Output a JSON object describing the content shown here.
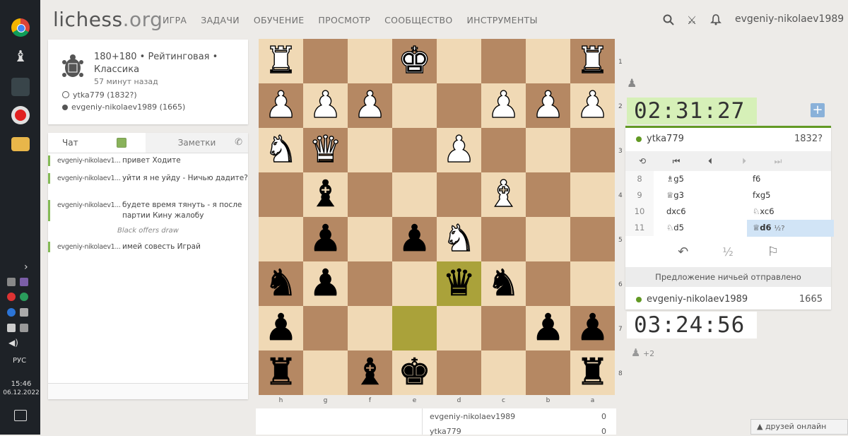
{
  "taskbar": {
    "lang": "РУС",
    "time": "15:46",
    "date": "06.12.2022"
  },
  "header": {
    "logo_main": "lichess",
    "logo_org": ".org",
    "nav": [
      "ИГРА",
      "ЗАДАЧИ",
      "ОБУЧЕНИЕ",
      "ПРОСМОТР",
      "СООБЩЕСТВО",
      "ИНСТРУМЕНТЫ"
    ],
    "username": "evgeniy-nikolaev1989"
  },
  "game_info": {
    "title": "180+180 • Рейтинговая • Классика",
    "ago": "57 минут назад",
    "white_player": "ytka779",
    "white_rating": "(1832?)",
    "black_player": "evgeniy-nikolaev1989",
    "black_rating": "(1665)"
  },
  "chat": {
    "tab_chat": "Чат",
    "tab_notes": "Заметки",
    "messages": [
      {
        "author": "evgeniy-nikolaev1...",
        "text": "привет Ходите"
      },
      {
        "author": "evgeniy-nikolaev1...",
        "text": "уйти я не уйду - Ничью дадите?"
      },
      {
        "author": "evgeniy-nikolaev1...",
        "text": "будете время тянуть - я после партии Кину жалобу"
      },
      {
        "author": "evgeniy-nikolaev1...",
        "text": "имей совесть Играй"
      }
    ],
    "system": "Black offers draw"
  },
  "board": {
    "files_bottom": [
      "h",
      "g",
      "f",
      "e",
      "d",
      "c",
      "b",
      "a"
    ],
    "ranks_right": [
      "1",
      "2",
      "3",
      "4",
      "5",
      "6",
      "7",
      "8"
    ],
    "highlight": [
      "d6",
      "e7"
    ],
    "pieces": [
      {
        "sq": "h1",
        "p": "♜",
        "c": "w"
      },
      {
        "sq": "e1",
        "p": "♚",
        "c": "w"
      },
      {
        "sq": "a1",
        "p": "♜",
        "c": "w"
      },
      {
        "sq": "h2",
        "p": "♟",
        "c": "w"
      },
      {
        "sq": "g2",
        "p": "♟",
        "c": "w"
      },
      {
        "sq": "f2",
        "p": "♟",
        "c": "w"
      },
      {
        "sq": "c2",
        "p": "♟",
        "c": "w"
      },
      {
        "sq": "b2",
        "p": "♟",
        "c": "w"
      },
      {
        "sq": "a2",
        "p": "♟",
        "c": "w"
      },
      {
        "sq": "h3",
        "p": "♞",
        "c": "w"
      },
      {
        "sq": "g3",
        "p": "♛",
        "c": "w"
      },
      {
        "sq": "d3",
        "p": "♟",
        "c": "w"
      },
      {
        "sq": "g4",
        "p": "♝",
        "c": "b"
      },
      {
        "sq": "c4",
        "p": "♝",
        "c": "w"
      },
      {
        "sq": "g5",
        "p": "♟",
        "c": "b"
      },
      {
        "sq": "e5",
        "p": "♟",
        "c": "b"
      },
      {
        "sq": "d5",
        "p": "♞",
        "c": "w"
      },
      {
        "sq": "h6",
        "p": "♞",
        "c": "b"
      },
      {
        "sq": "g6",
        "p": "♟",
        "c": "b"
      },
      {
        "sq": "d6",
        "p": "♛",
        "c": "b"
      },
      {
        "sq": "c6",
        "p": "♞",
        "c": "b"
      },
      {
        "sq": "h7",
        "p": "♟",
        "c": "b"
      },
      {
        "sq": "b7",
        "p": "♟",
        "c": "b"
      },
      {
        "sq": "a7",
        "p": "♟",
        "c": "b"
      },
      {
        "sq": "h8",
        "p": "♜",
        "c": "b"
      },
      {
        "sq": "f8",
        "p": "♝",
        "c": "b"
      },
      {
        "sq": "e8",
        "p": "♚",
        "c": "b"
      },
      {
        "sq": "a8",
        "p": "♜",
        "c": "b"
      }
    ]
  },
  "under_board": {
    "rows": [
      {
        "name": "evgeniy-nikolaev1989",
        "score": "0"
      },
      {
        "name": "ytka779",
        "score": "0"
      }
    ]
  },
  "right_panel": {
    "clock_top": "02:31:27",
    "clock_bottom": "03:24:56",
    "top_player": "ytka779",
    "top_rating": "1832?",
    "bottom_player": "evgeniy-nikolaev1989",
    "bottom_rating": "1665",
    "moves": [
      {
        "n": "8",
        "w": "♗g5",
        "b": "f6",
        "ann": ""
      },
      {
        "n": "9",
        "w": "♕g3",
        "b": "fxg5",
        "ann": ""
      },
      {
        "n": "10",
        "w": "dxc6",
        "b": "♘xc6",
        "ann": ""
      },
      {
        "n": "11",
        "w": "♘d5",
        "b": "♕d6",
        "ann": "½?"
      }
    ],
    "draw_half": "½",
    "draw_sent": "Предложение ничьей отправлено",
    "spectators": "+2"
  },
  "footer": {
    "friends": "▲ друзей онлайн"
  },
  "colors": {
    "light_square": "#f0d9b5",
    "dark_square": "#b58863",
    "accent_green": "#629924"
  }
}
